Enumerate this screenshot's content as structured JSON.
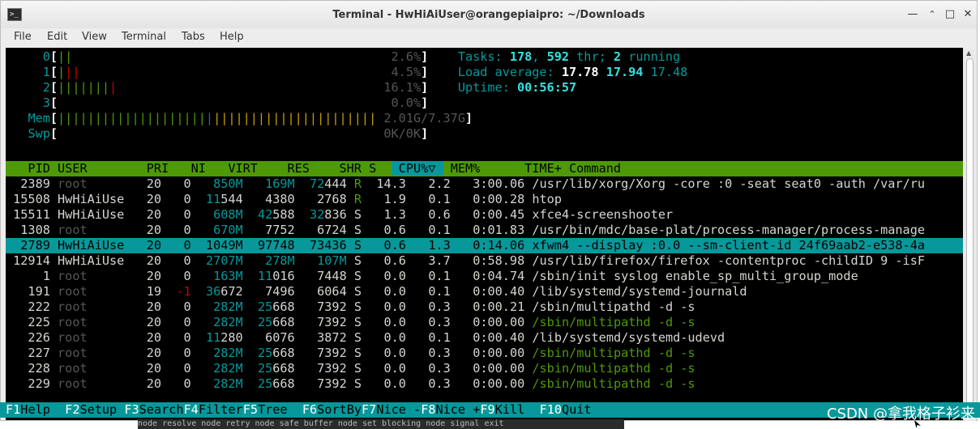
{
  "window": {
    "title": "Terminal - HwHiAiUser@orangepiaipro: ~/Downloads",
    "menu": [
      "File",
      "Edit",
      "View",
      "Terminal",
      "Tabs",
      "Help"
    ]
  },
  "htop": {
    "cpus": [
      {
        "id": "0",
        "bars": [
          [
            "g",
            "||"
          ]
        ],
        "pct": "2.6%"
      },
      {
        "id": "1",
        "bars": [
          [
            "g",
            "|"
          ],
          [
            "r",
            "||"
          ]
        ],
        "pct": "4.5%"
      },
      {
        "id": "2",
        "bars": [
          [
            "g",
            "|||||||"
          ],
          [
            "r",
            "|"
          ]
        ],
        "pct": "16.1%"
      },
      {
        "id": "3",
        "bars": [],
        "pct": "0.0%"
      }
    ],
    "mem": {
      "label": "Mem",
      "value": "2.01G/7.37G"
    },
    "swp": {
      "label": "Swp",
      "value": "0K/0K"
    },
    "tasks": {
      "label": "Tasks: ",
      "count": "178",
      "thr": "592",
      "thr_label": " thr; ",
      "running": "2",
      "running_label": " running"
    },
    "load": {
      "label": "Load average: ",
      "v1": "17.78",
      "v5": "17.94",
      "v15": "17.48"
    },
    "uptime": {
      "label": "Uptime: ",
      "value": "00:56:57"
    },
    "columns": [
      "PID",
      "USER",
      "PRI",
      "NI",
      "VIRT",
      "RES",
      "SHR",
      "S",
      "CPU%▽",
      "MEM%",
      "TIME+",
      "Command"
    ],
    "processes": [
      {
        "pid": "2389",
        "user": "root",
        "pri": "20",
        "ni": "0",
        "virt": "850M",
        "res": "169M",
        "shr": "72444",
        "s": "R",
        "cpu": "14.3",
        "mem": "2.2",
        "time": "3:00.06",
        "cmd": "/usr/lib/xorg/Xorg -core :0 -seat seat0 -auth /var/ru",
        "thread": false
      },
      {
        "pid": "15508",
        "user": "HwHiAiUse",
        "pri": "20",
        "ni": "0",
        "virt": "11544",
        "res": "4380",
        "shr": "2768",
        "s": "R",
        "cpu": "1.9",
        "mem": "0.1",
        "time": "0:00.28",
        "cmd": "htop",
        "thread": false
      },
      {
        "pid": "15511",
        "user": "HwHiAiUse",
        "pri": "20",
        "ni": "0",
        "virt": "608M",
        "res": "42588",
        "shr": "32836",
        "s": "S",
        "cpu": "1.3",
        "mem": "0.6",
        "time": "0:00.45",
        "cmd": "xfce4-screenshooter",
        "thread": false
      },
      {
        "pid": "1308",
        "user": "root",
        "pri": "20",
        "ni": "0",
        "virt": "670M",
        "res": "7752",
        "shr": "6724",
        "s": "S",
        "cpu": "0.6",
        "mem": "0.1",
        "time": "0:01.83",
        "cmd": "/usr/bin/mdc/base-plat/process-manager/process-manage",
        "thread": false
      },
      {
        "pid": "2789",
        "user": "HwHiAiUse",
        "pri": "20",
        "ni": "0",
        "virt": "1049M",
        "res": "97748",
        "shr": "73436",
        "s": "S",
        "cpu": "0.6",
        "mem": "1.3",
        "time": "0:14.06",
        "cmd": "xfwm4 --display :0.0 --sm-client-id 24f69aab2-e538-4a",
        "thread": false,
        "selected": true
      },
      {
        "pid": "12914",
        "user": "HwHiAiUse",
        "pri": "20",
        "ni": "0",
        "virt": "2707M",
        "res": "278M",
        "shr": "107M",
        "s": "S",
        "cpu": "0.6",
        "mem": "3.7",
        "time": "0:58.98",
        "cmd": "/usr/lib/firefox/firefox -contentproc -childID 9 -isF",
        "thread": false
      },
      {
        "pid": "1",
        "user": "root",
        "pri": "20",
        "ni": "0",
        "virt": "163M",
        "res": "11016",
        "shr": "7448",
        "s": "S",
        "cpu": "0.0",
        "mem": "0.1",
        "time": "0:04.74",
        "cmd": "/sbin/init syslog enable_sp_multi_group_mode",
        "thread": false
      },
      {
        "pid": "191",
        "user": "root",
        "pri": "19",
        "ni": "-1",
        "virt": "36672",
        "res": "7496",
        "shr": "6064",
        "s": "S",
        "cpu": "0.0",
        "mem": "0.1",
        "time": "0:00.40",
        "cmd": "/lib/systemd/systemd-journald",
        "thread": false
      },
      {
        "pid": "222",
        "user": "root",
        "pri": "20",
        "ni": "0",
        "virt": "282M",
        "res": "25668",
        "shr": "7392",
        "s": "S",
        "cpu": "0.0",
        "mem": "0.3",
        "time": "0:00.21",
        "cmd": "/sbin/multipathd -d -s",
        "thread": false
      },
      {
        "pid": "225",
        "user": "root",
        "pri": "20",
        "ni": "0",
        "virt": "282M",
        "res": "25668",
        "shr": "7392",
        "s": "S",
        "cpu": "0.0",
        "mem": "0.3",
        "time": "0:00.00",
        "cmd": "/sbin/multipathd -d -s",
        "thread": true
      },
      {
        "pid": "226",
        "user": "root",
        "pri": "20",
        "ni": "0",
        "virt": "11280",
        "res": "6076",
        "shr": "3872",
        "s": "S",
        "cpu": "0.0",
        "mem": "0.1",
        "time": "0:00.40",
        "cmd": "/lib/systemd/systemd-udevd",
        "thread": false
      },
      {
        "pid": "227",
        "user": "root",
        "pri": "20",
        "ni": "0",
        "virt": "282M",
        "res": "25668",
        "shr": "7392",
        "s": "S",
        "cpu": "0.0",
        "mem": "0.3",
        "time": "0:00.00",
        "cmd": "/sbin/multipathd -d -s",
        "thread": true
      },
      {
        "pid": "228",
        "user": "root",
        "pri": "20",
        "ni": "0",
        "virt": "282M",
        "res": "25668",
        "shr": "7392",
        "s": "S",
        "cpu": "0.0",
        "mem": "0.3",
        "time": "0:00.00",
        "cmd": "/sbin/multipathd -d -s",
        "thread": true
      },
      {
        "pid": "229",
        "user": "root",
        "pri": "20",
        "ni": "0",
        "virt": "282M",
        "res": "25668",
        "shr": "7392",
        "s": "S",
        "cpu": "0.0",
        "mem": "0.3",
        "time": "0:00.00",
        "cmd": "/sbin/multipathd -d -s",
        "thread": true
      }
    ],
    "fkeys": [
      {
        "key": "F1",
        "label": "Help  "
      },
      {
        "key": "F2",
        "label": "Setup "
      },
      {
        "key": "F3",
        "label": "Search"
      },
      {
        "key": "F4",
        "label": "Filter"
      },
      {
        "key": "F5",
        "label": "Tree  "
      },
      {
        "key": "F6",
        "label": "SortBy"
      },
      {
        "key": "F7",
        "label": "Nice -"
      },
      {
        "key": "F8",
        "label": "Nice +"
      },
      {
        "key": "F9",
        "label": "Kill  "
      },
      {
        "key": "F10",
        "label": "Quit"
      }
    ]
  },
  "watermark": "CSDN @拿我格子衫来",
  "behind_text": "node resolve node retry node safe buffer node set blocking node signal exit"
}
